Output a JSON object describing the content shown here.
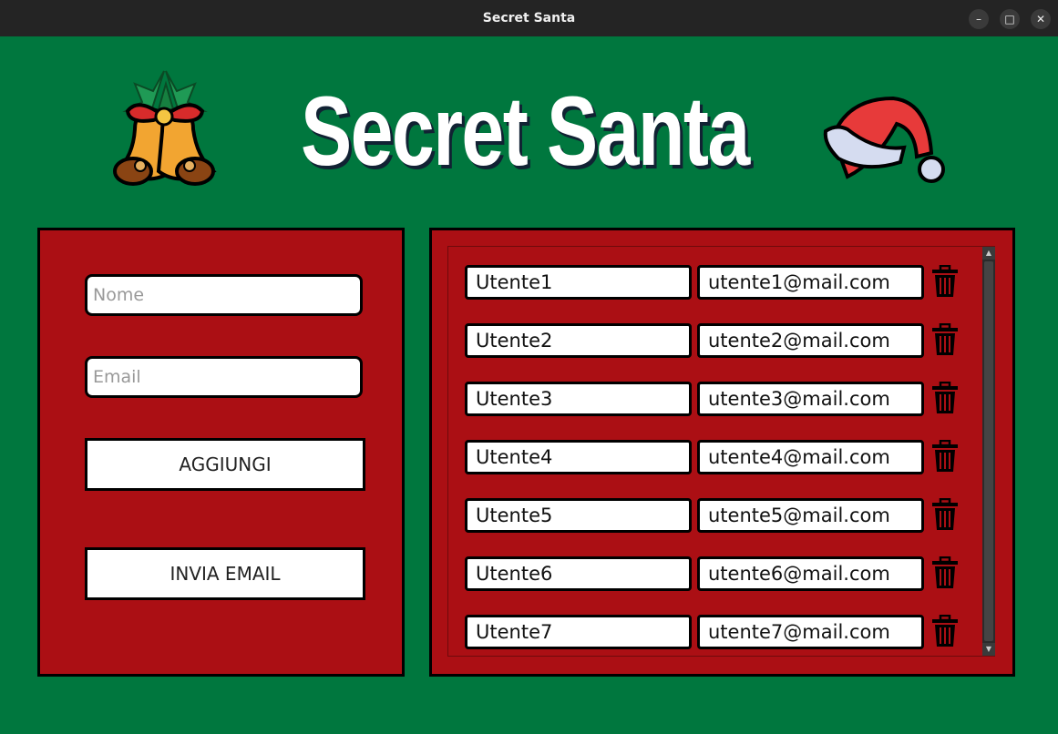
{
  "window": {
    "title": "Secret Santa"
  },
  "header": {
    "title": "Secret Santa"
  },
  "form": {
    "name_placeholder": "Nome",
    "email_placeholder": "Email",
    "add_label": "AGGIUNGI",
    "send_label": "INVIA EMAIL"
  },
  "participants": [
    {
      "name": "Utente1",
      "email": "utente1@mail.com"
    },
    {
      "name": "Utente2",
      "email": "utente2@mail.com"
    },
    {
      "name": "Utente3",
      "email": "utente3@mail.com"
    },
    {
      "name": "Utente4",
      "email": "utente4@mail.com"
    },
    {
      "name": "Utente5",
      "email": "utente5@mail.com"
    },
    {
      "name": "Utente6",
      "email": "utente6@mail.com"
    },
    {
      "name": "Utente7",
      "email": "utente7@mail.com"
    }
  ],
  "colors": {
    "background": "#00773e",
    "panel": "#ab0f14",
    "titlebar": "#242424"
  },
  "icons": {
    "delete": "trash-icon",
    "decoration_left": "bells-icon",
    "decoration_right": "santa-hat-icon"
  }
}
